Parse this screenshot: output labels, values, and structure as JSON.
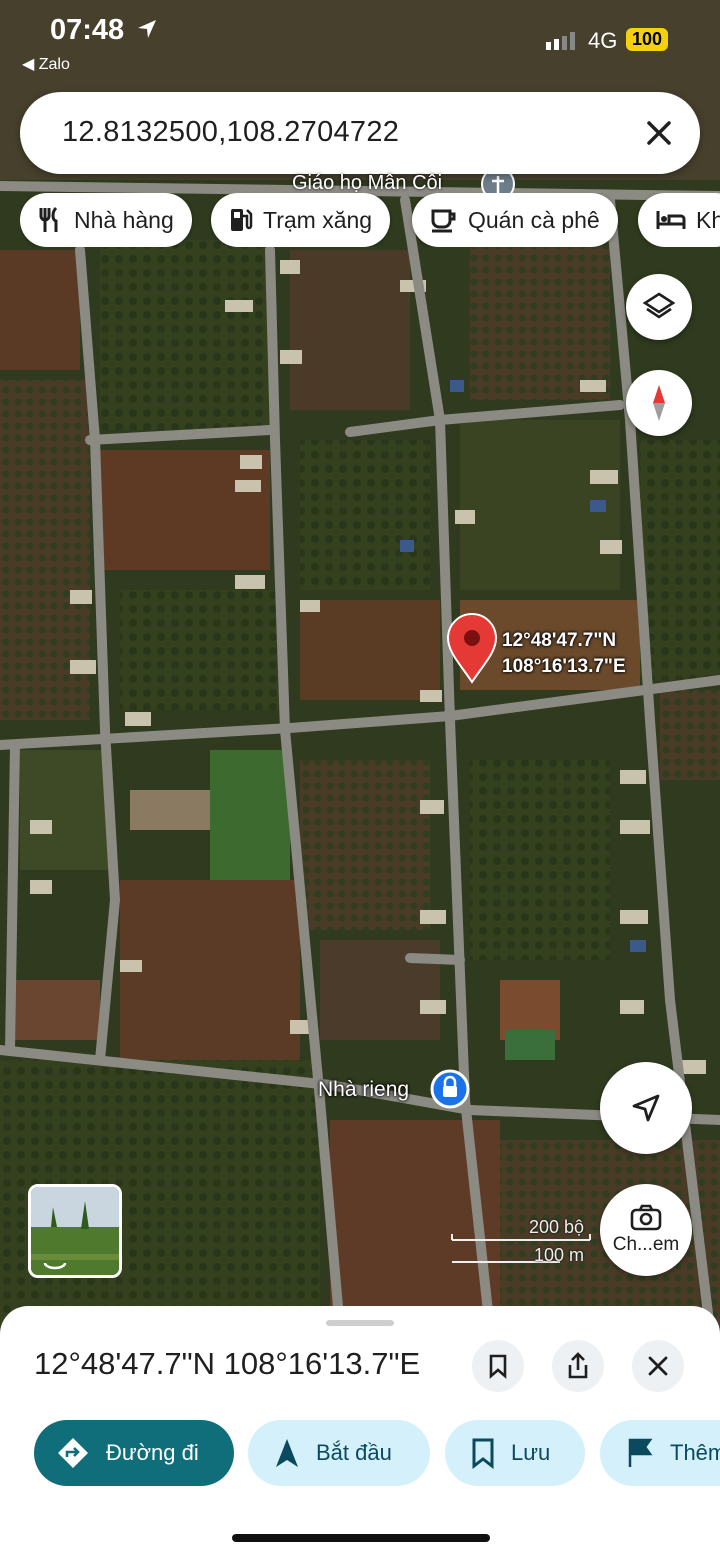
{
  "status_bar": {
    "time": "07:48",
    "back_app": "◀ Zalo",
    "network": "4G",
    "battery": "100"
  },
  "search": {
    "query": "12.8132500,108.2704722"
  },
  "chips": [
    {
      "label": "Nhà hàng",
      "icon": "restaurant-icon"
    },
    {
      "label": "Trạm xăng",
      "icon": "gas-station-icon"
    },
    {
      "label": "Quán cà phê",
      "icon": "coffee-icon"
    },
    {
      "label": "Kh",
      "icon": "hotel-icon"
    }
  ],
  "map": {
    "top_label": "Giáo họ Mân Côi",
    "pin_lat": "12°48'47.7\"N",
    "pin_lng": "108°16'13.7\"E",
    "place_label": "Nhà rieng",
    "scale_ft": "200 bộ",
    "scale_m": "100 m",
    "layers_icon": "layers-icon",
    "compass_icon": "compass-icon",
    "my_location_icon": "navigation-arrow-icon",
    "camera_label": "Ch...em"
  },
  "sheet": {
    "title": "12°48'47.7\"N 108°16'13.7\"E",
    "actions": [
      {
        "label": "Đường đi",
        "icon": "directions-icon"
      },
      {
        "label": "Bắt đầu",
        "icon": "navigate-icon"
      },
      {
        "label": "Lưu",
        "icon": "bookmark-icon"
      },
      {
        "label": "Thêm",
        "icon": "flag-icon"
      }
    ]
  },
  "colors": {
    "primary_action": "#0f6e7a",
    "secondary_action": "#d3f0fb",
    "pin": "#e53935"
  }
}
